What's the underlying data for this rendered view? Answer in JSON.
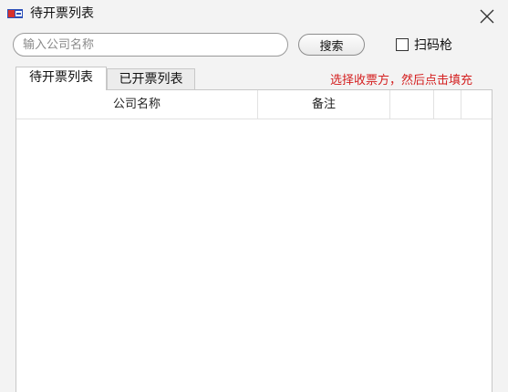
{
  "window": {
    "title": "待开票列表",
    "app_icon": "app-flag-icon",
    "close_icon": "close-icon"
  },
  "search": {
    "placeholder": "输入公司名称",
    "value": "",
    "button_label": "搜索"
  },
  "scanner": {
    "label": "扫码枪",
    "checked": false
  },
  "tabs": [
    {
      "label": "待开票列表",
      "active": true
    },
    {
      "label": "已开票列表",
      "active": false
    }
  ],
  "hint": "选择收票方，然后点击填充",
  "table": {
    "columns": [
      "公司名称",
      "备注",
      "",
      ""
    ],
    "rows": []
  },
  "colors": {
    "hint": "#d42020",
    "window_bg": "#f3f3f3"
  }
}
